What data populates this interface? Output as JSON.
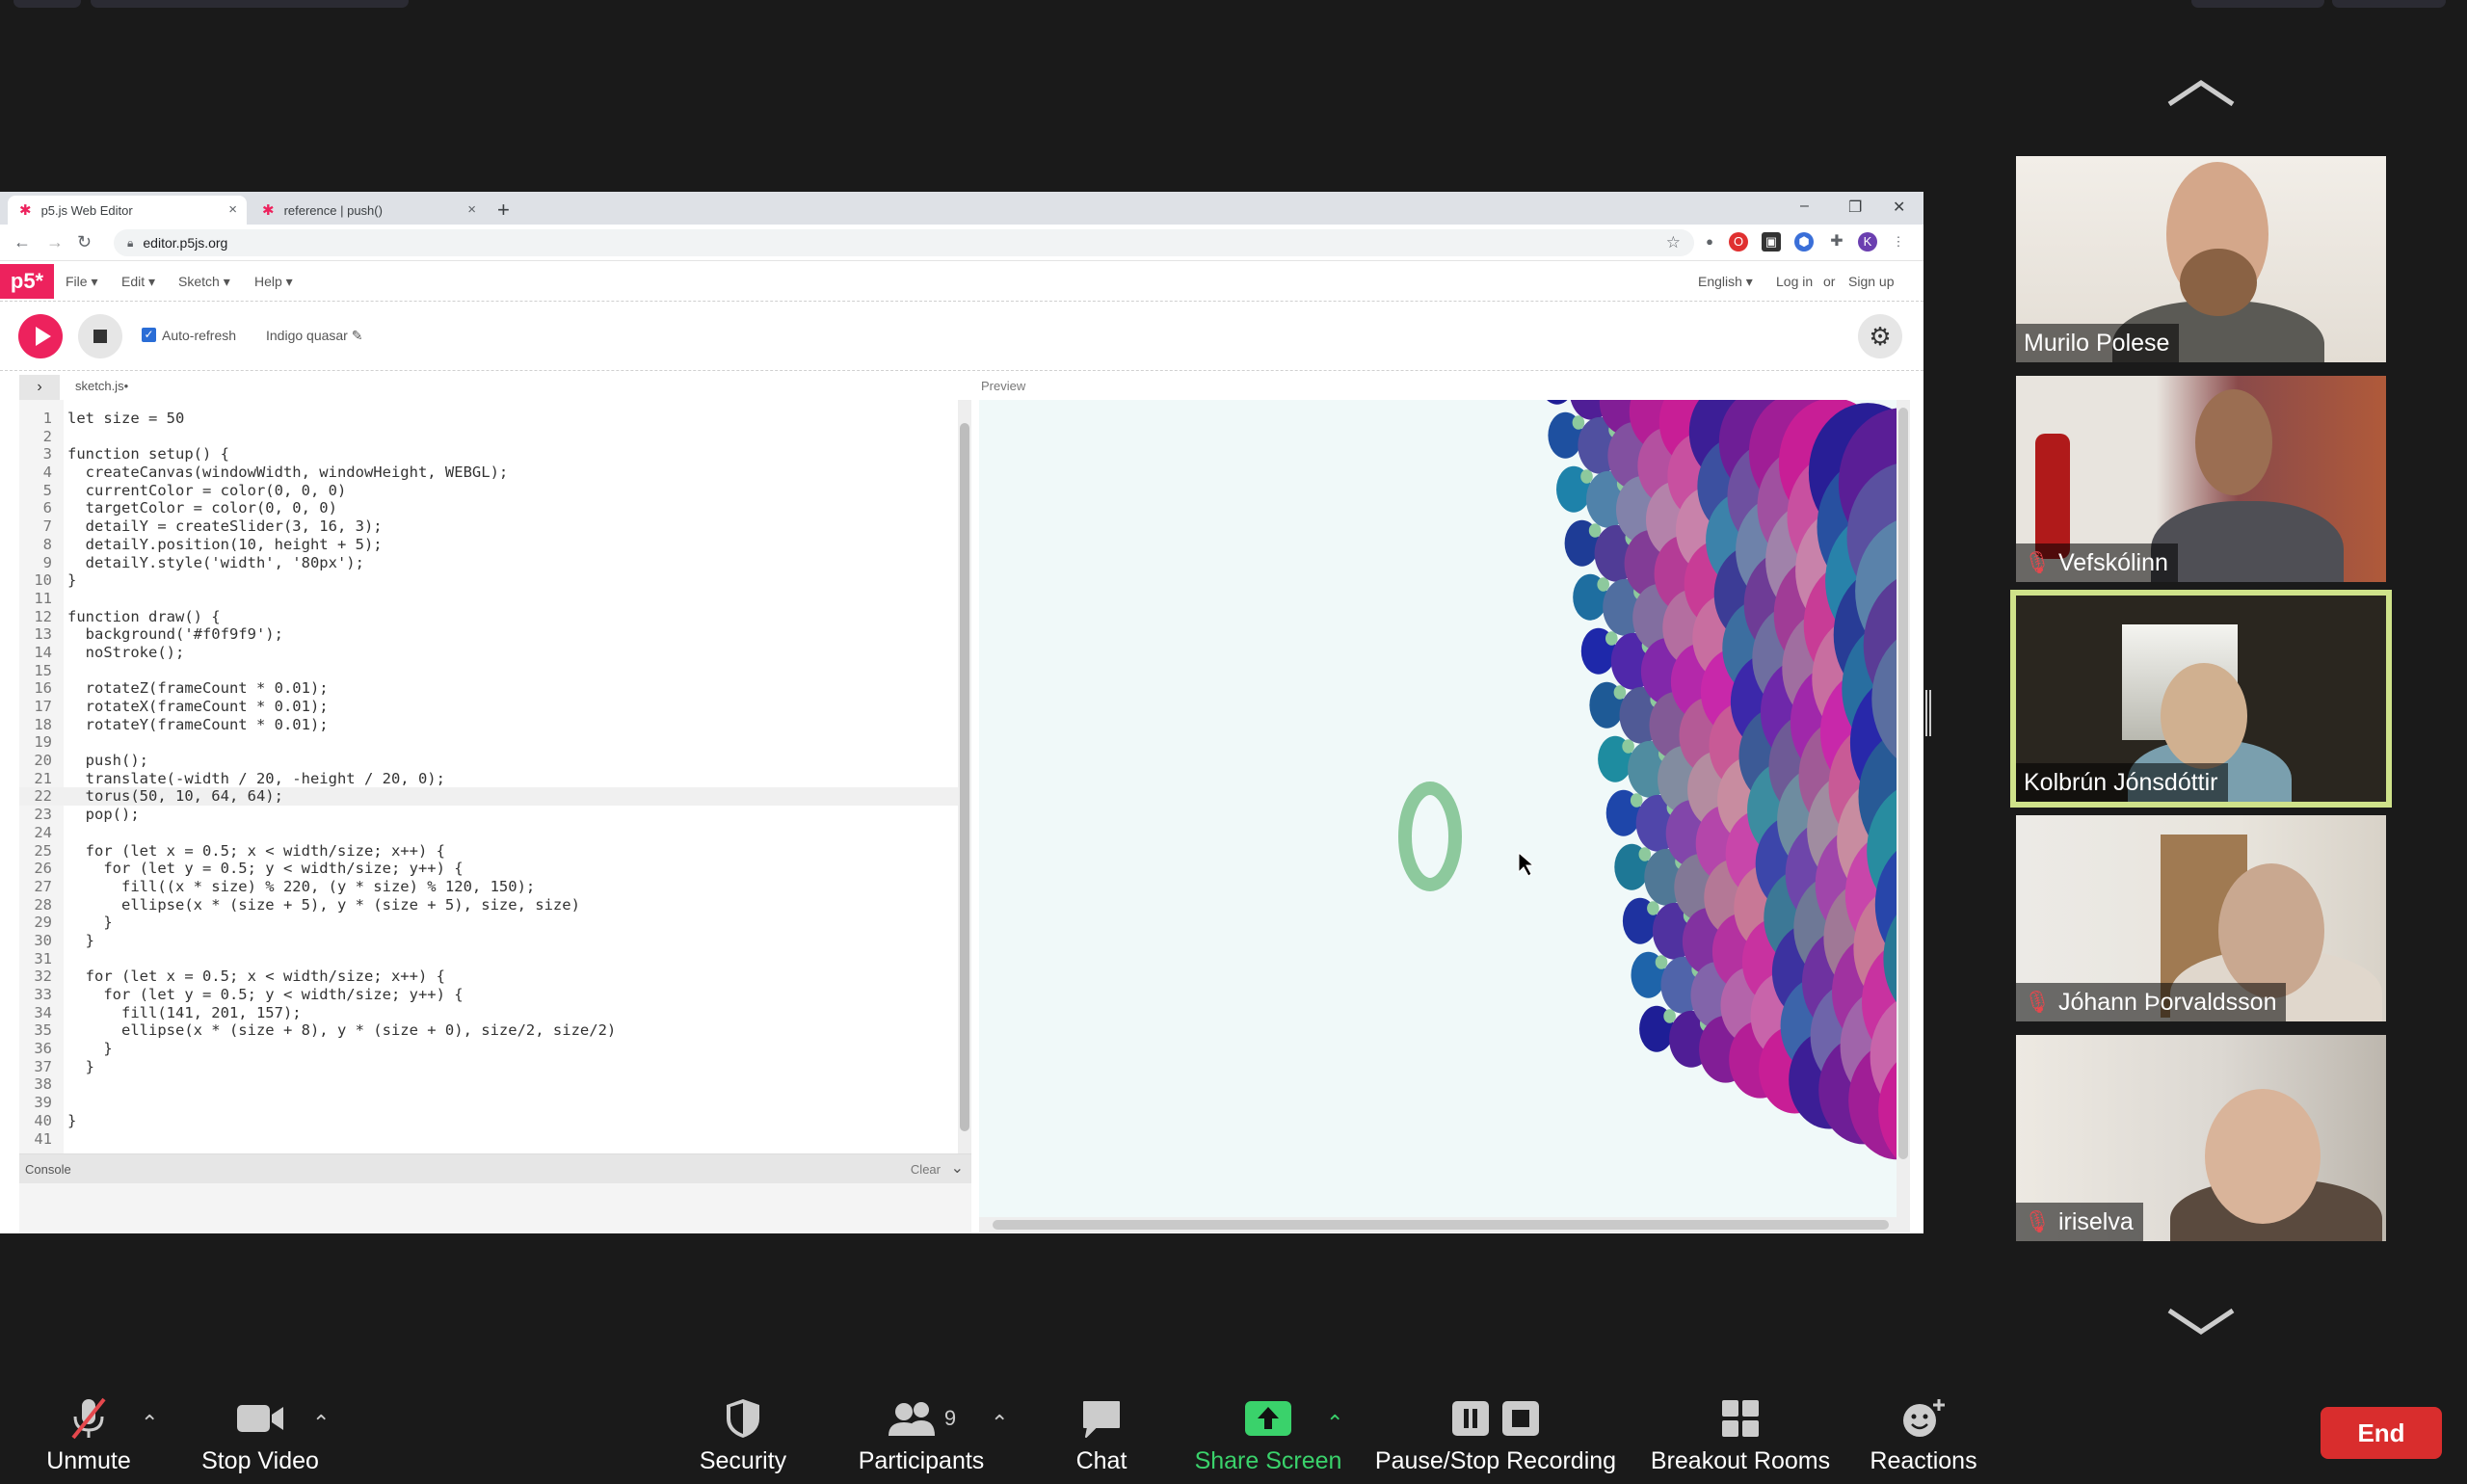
{
  "browser": {
    "tabs": [
      {
        "title": "p5.js Web Editor"
      },
      {
        "title": "reference | push()"
      }
    ],
    "url": "editor.p5js.org",
    "profile_initial": "K"
  },
  "p5editor": {
    "logo": "p5*",
    "menus": [
      "File ▾",
      "Edit ▾",
      "Sketch ▾",
      "Help ▾"
    ],
    "language": "English ▾",
    "login": "Log in",
    "or": "or",
    "signup": "Sign up",
    "autorefresh_label": "Auto-refresh",
    "sketch_name": "Indigo quasar ✎",
    "file_name": "sketch.js•",
    "preview_label": "Preview",
    "console_label": "Console",
    "console_clear": "Clear",
    "code_lines": [
      "let size = 50",
      "",
      "function setup() {",
      "  createCanvas(windowWidth, windowHeight, WEBGL);",
      "  currentColor = color(0, 0, 0)",
      "  targetColor = color(0, 0, 0)",
      "  detailY = createSlider(3, 16, 3);",
      "  detailY.position(10, height + 5);",
      "  detailY.style('width', '80px');",
      "}",
      "",
      "function draw() {",
      "  background('#f0f9f9');",
      "  noStroke();",
      "",
      "  rotateZ(frameCount * 0.01);",
      "  rotateX(frameCount * 0.01);",
      "  rotateY(frameCount * 0.01);",
      "",
      "  push();",
      "  translate(-width / 20, -height / 20, 0);",
      "  torus(50, 10, 64, 64);",
      "  pop();",
      "",
      "  for (let x = 0.5; x < width/size; x++) {",
      "    for (let y = 0.5; y < width/size; y++) {",
      "      fill((x * size) % 220, (y * size) % 120, 150);",
      "      ellipse(x * (size + 5), y * (size + 5), size, size)",
      "    }",
      "  }",
      "",
      "  for (let x = 0.5; x < width/size; x++) {",
      "    for (let y = 0.5; y < width/size; y++) {",
      "      fill(141, 201, 157);",
      "      ellipse(x * (size + 8), y * (size + 0), size/2, size/2)",
      "    }",
      "  }",
      "",
      "",
      "}",
      ""
    ]
  },
  "participants": [
    {
      "name": "Murilo Polese",
      "muted": false
    },
    {
      "name": "Vefskólinn",
      "muted": true
    },
    {
      "name": "Kolbrún Jónsdóttir",
      "muted": false,
      "active_speaker": true
    },
    {
      "name": "Jóhann Þorvaldsson",
      "muted": true
    },
    {
      "name": "iriselva",
      "muted": true
    }
  ],
  "toolbar": {
    "unmute": "Unmute",
    "stop_video": "Stop Video",
    "security": "Security",
    "participants": "Participants",
    "participants_count": "9",
    "chat": "Chat",
    "share_screen": "Share Screen",
    "pause_stop_recording": "Pause/Stop Recording",
    "breakout_rooms": "Breakout Rooms",
    "reactions": "Reactions",
    "end": "End"
  },
  "colors": {
    "p5_pink": "#ed225d",
    "share_green": "#3ad26b",
    "end_red": "#d92d2d",
    "active_speaker_border": "#cfe28a",
    "preview_background": "#f0f9f9",
    "torus_green": "#8dc99d"
  }
}
